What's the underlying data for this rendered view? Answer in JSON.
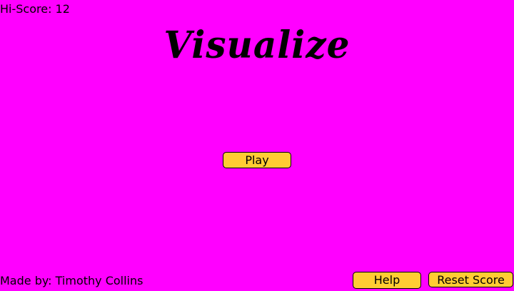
{
  "hiscore": {
    "label": "Hi-Score:",
    "value": "12"
  },
  "title": "Visualize",
  "buttons": {
    "play": "Play",
    "help": "Help",
    "reset": "Reset Score"
  },
  "credit": "Made by: Timothy Collins",
  "colors": {
    "background": "#ff00ff",
    "button": "#ffcc33",
    "text": "#000000"
  }
}
